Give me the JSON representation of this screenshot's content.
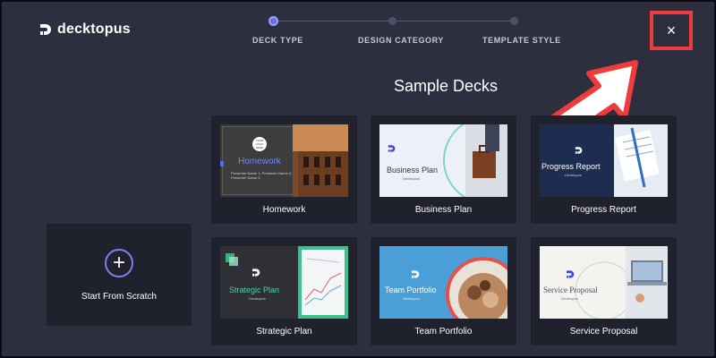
{
  "brand": {
    "name": "decktopus"
  },
  "stepper": {
    "steps": [
      {
        "label": "DECK TYPE",
        "active": true
      },
      {
        "label": "DESIGN CATEGORY",
        "active": false
      },
      {
        "label": "TEMPLATE STYLE",
        "active": false
      }
    ]
  },
  "close_button": {
    "label": "×",
    "highlight_color": "#ee3b3b"
  },
  "section_title": "Sample Decks",
  "scratch": {
    "label": "Start From Scratch",
    "icon": "plus-icon"
  },
  "decks": [
    {
      "label": "Homework",
      "thumb_title": "Homework",
      "thumb_lines": [
        "Presenter Name 1, Presenter Name 2,",
        "Presenter Name 3"
      ],
      "thumb_badge": "YOUR LOGO HERE"
    },
    {
      "label": "Business Plan",
      "thumb_title": "Business Plan",
      "thumb_sub": "Decktopus"
    },
    {
      "label": "Progress Report",
      "thumb_title": "Progress Report",
      "thumb_sub": "Decktopus"
    },
    {
      "label": "Strategic Plan",
      "thumb_title": "Strategic Plan",
      "thumb_sub": "Decktopus"
    },
    {
      "label": "Team Portfolio",
      "thumb_title": "Team Portfolio",
      "thumb_sub": "Decktopus"
    },
    {
      "label": "Service Proposal",
      "thumb_title": "Service Proposal",
      "thumb_sub": "Decktopus"
    }
  ],
  "colors": {
    "background": "#2d2f3f",
    "card": "#1f212c",
    "accent": "#6a6fe0",
    "annotation": "#ee3b3b"
  }
}
